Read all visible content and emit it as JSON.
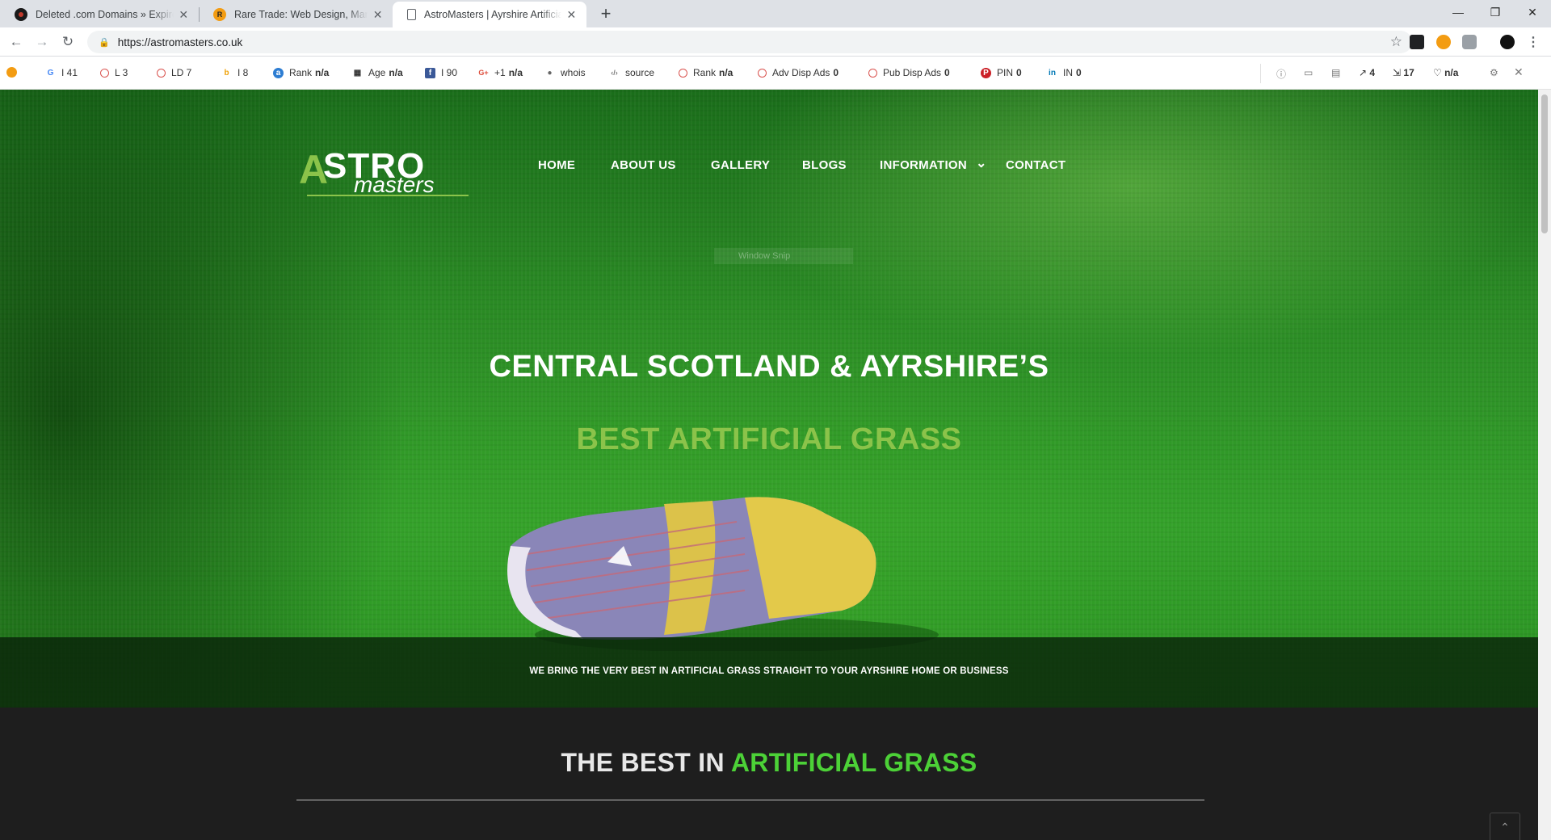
{
  "browser": {
    "tabs": [
      {
        "title": "Deleted .com Domains » Expired",
        "favicon_color": "#8b0000"
      },
      {
        "title": "Rare Trade: Web Design, Marketi",
        "favicon_color": "#c0392b"
      },
      {
        "title": "AstroMasters | Ayrshire Artificial",
        "favicon_color": "#ffffff",
        "active": true
      }
    ],
    "new_tab_label": "+",
    "close_label": "✕",
    "url": "https://astromasters.co.uk"
  },
  "seo_toolbar": {
    "items": [
      {
        "icon": "google-icon",
        "glyph": "G",
        "color": "#4285f4",
        "label": "I 41",
        "value": ""
      },
      {
        "icon": "ring-icon",
        "glyph": "",
        "color": "#d9534f",
        "label": "L 3",
        "value": ""
      },
      {
        "icon": "ring-icon",
        "glyph": "",
        "color": "#d9534f",
        "label": "LD 7",
        "value": ""
      },
      {
        "icon": "bing-icon",
        "glyph": "b",
        "color": "#f0a30a",
        "label": "I 8",
        "value": ""
      },
      {
        "icon": "alexa-icon",
        "glyph": "a",
        "color": "#2d7dd2",
        "label": "Rank",
        "value": "n/a"
      },
      {
        "icon": "calendar-icon",
        "glyph": "▦",
        "color": "#333333",
        "label": "Age",
        "value": "n/a"
      },
      {
        "icon": "facebook-icon",
        "glyph": "f",
        "color": "#3b5998",
        "label": "I 90",
        "value": ""
      },
      {
        "icon": "google-plus-icon",
        "glyph": "G+",
        "color": "#dd4b39",
        "label": "+1",
        "value": "n/a"
      },
      {
        "icon": "person-icon",
        "glyph": "●",
        "color": "#666666",
        "label": "whois",
        "value": ""
      },
      {
        "icon": "code-icon",
        "glyph": "‹/›",
        "color": "#666666",
        "label": "source",
        "value": ""
      },
      {
        "icon": "ring-icon",
        "glyph": "",
        "color": "#d9534f",
        "label": "Rank",
        "value": "n/a"
      },
      {
        "icon": "ring-icon",
        "glyph": "",
        "color": "#d9534f",
        "label": "Adv Disp Ads",
        "value": "0"
      },
      {
        "icon": "ring-icon",
        "glyph": "",
        "color": "#d9534f",
        "label": "Pub Disp Ads",
        "value": "0"
      },
      {
        "icon": "pinterest-icon",
        "glyph": "P",
        "color": "#cb2027",
        "label": "PIN",
        "value": "0"
      },
      {
        "icon": "linkedin-icon",
        "glyph": "in",
        "color": "#0077b5",
        "label": "IN",
        "value": "0"
      }
    ],
    "right": {
      "external_links": "4",
      "internal_links": "17",
      "heart_value": "n/a"
    }
  },
  "site": {
    "logo": {
      "a": "A",
      "stro": "STRO",
      "masters": "masters"
    },
    "nav": [
      "HOME",
      "ABOUT US",
      "GALLERY",
      "BLOGS",
      "INFORMATION",
      "CONTACT"
    ],
    "nav_dropdown_glyph": "⌄",
    "snip_text": "Window Snip",
    "hero_title": "CENTRAL SCOTLAND & AYRSHIRE’S",
    "hero_subtitle": "BEST ARTIFICIAL GRASS",
    "banner_text": "WE BRING THE VERY BEST IN ARTIFICIAL GRASS STRAIGHT TO YOUR AYRSHIRE HOME OR BUSINESS",
    "section_title_prefix": "THE BEST IN",
    "section_title_accent": "ARTIFICIAL GRASS",
    "colors": {
      "accent_green": "#8bc34a",
      "bright_green": "#4cd137",
      "dark_bg": "#1e1e1e"
    }
  }
}
